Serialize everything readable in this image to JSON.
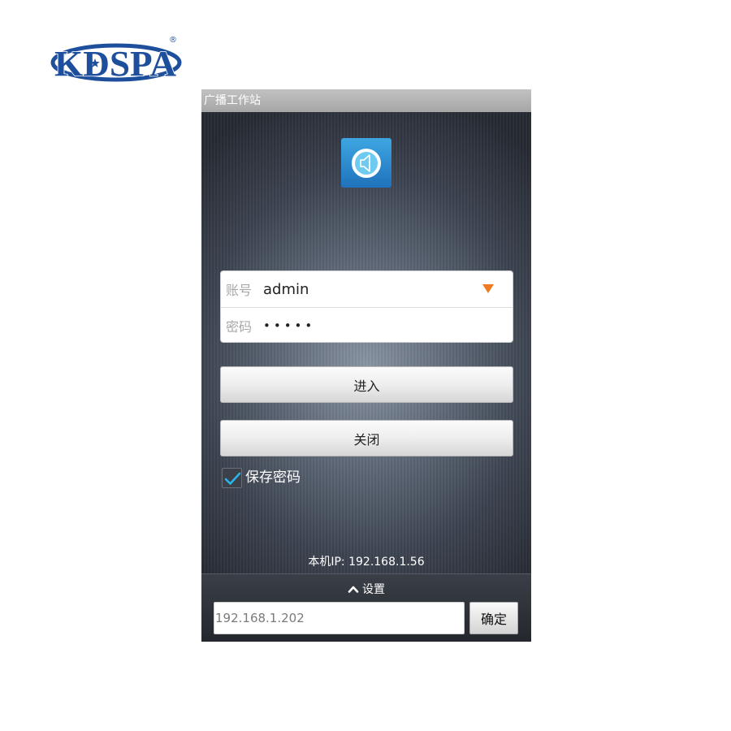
{
  "logo": {
    "text": "KDSPA",
    "registered": "®"
  },
  "app": {
    "title": "广播工作站"
  },
  "login": {
    "account_label": "账号",
    "account_value": "admin",
    "password_label": "密码",
    "password_value": "•••••"
  },
  "buttons": {
    "enter": "进入",
    "close": "关闭"
  },
  "save_password": {
    "label": "保存密码",
    "checked": true
  },
  "status": {
    "local_ip": "本机IP: 192.168.1.56"
  },
  "settings": {
    "toggle_label": "设置",
    "server_value": "192.168.1.202",
    "confirm_label": "确定"
  },
  "icons": {
    "app": "speaker-icon",
    "account_dropdown": "triangle-down-icon",
    "save_password_check": "checkmark-icon",
    "settings_toggle": "chevron-up-icon",
    "logo_star": "star-icon"
  },
  "colors": {
    "logo_blue": "#1d4f9c",
    "app_icon_blue": "#2a8fd4",
    "dropdown_orange": "#f07a22",
    "check_cyan": "#2bb5ea",
    "title_bar_gray": "#b3b3b3"
  }
}
